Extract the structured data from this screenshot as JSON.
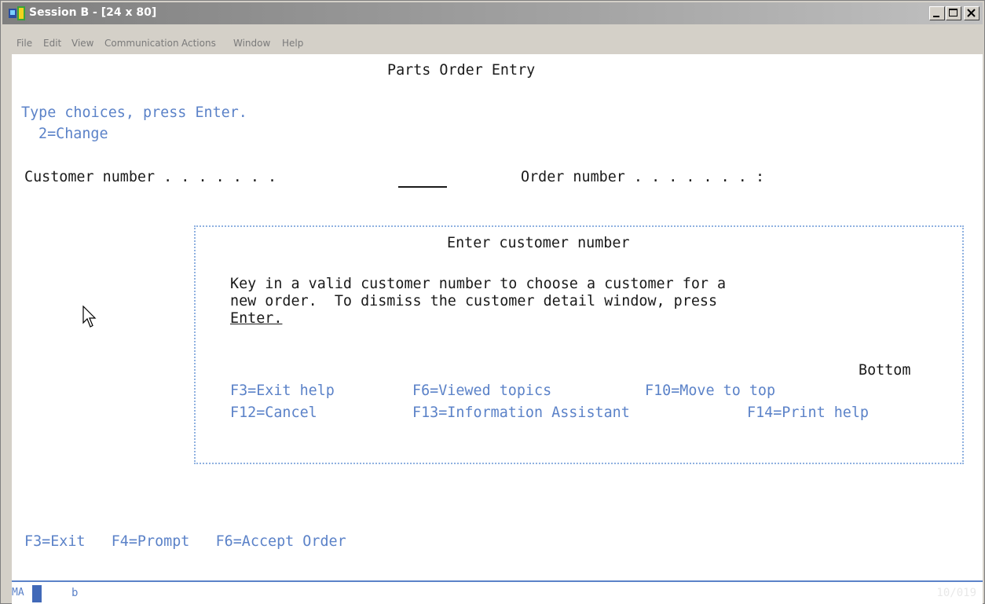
{
  "window": {
    "title": "Session B - [24 x 80]"
  },
  "menu": {
    "items": [
      {
        "label": "File",
        "accel": "F"
      },
      {
        "label": "Edit",
        "accel": "E"
      },
      {
        "label": "View",
        "accel": "V"
      },
      {
        "label": "Communication",
        "accel": "C"
      },
      {
        "label": "Actions",
        "accel": "A"
      },
      {
        "label": "Window",
        "accel": "W"
      },
      {
        "label": "Help",
        "accel": "H"
      }
    ]
  },
  "screen": {
    "title": "Parts Order Entry",
    "instruction": "Type choices, press Enter.",
    "option": "2=Change",
    "customer_label": "Customer number . . . . . . .",
    "customer_value": "",
    "order_label": "Order number . . . . . . . :",
    "order_value": "",
    "function_keys": "F3=Exit   F4=Prompt   F6=Accept Order"
  },
  "help_window": {
    "title": "Enter customer number",
    "line1": "Key in a valid customer number to choose a customer for a",
    "line2": "new order.  To dismiss the customer detail window, press",
    "link": "Enter.",
    "position": "Bottom",
    "keys_row1": [
      {
        "label": "F3=Exit help"
      },
      {
        "label": "F6=Viewed topics"
      },
      {
        "label": "F10=Move to top"
      }
    ],
    "keys_row2": [
      {
        "label": "F12=Cancel"
      },
      {
        "label": "F13=Information Assistant"
      },
      {
        "label": "F14=Print help"
      }
    ]
  },
  "status": {
    "mode": "MA",
    "session": "b",
    "cursor_pos": "10/019"
  },
  "colors": {
    "field_text": "#1a1a1a",
    "info_text": "#5b82c8",
    "border_dots": "#8fb1e0",
    "titlebar": "#7f7f7f"
  }
}
